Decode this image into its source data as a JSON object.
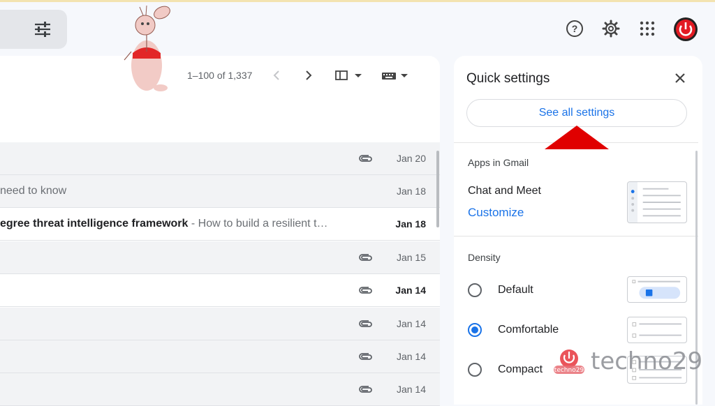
{
  "header": {
    "filter_icon": "tune-icon",
    "help_icon": "help-icon",
    "settings_icon": "gear-icon",
    "apps_icon": "apps-grid-icon",
    "avatar_icon": "power-avatar-icon"
  },
  "toolbar": {
    "pagination": "1–100 of 1,337",
    "prev_icon": "chevron-left-icon",
    "next_icon": "chevron-right-icon",
    "split_icon": "split-pane-icon",
    "input_tools_icon": "keyboard-icon"
  },
  "emails": [
    {
      "subject": "",
      "snippet": "",
      "date": "Jan 20",
      "attachment": true,
      "unread": false
    },
    {
      "subject": "",
      "snippet": "need to know",
      "date": "Jan 18",
      "attachment": false,
      "unread": false
    },
    {
      "subject": "egree threat intelligence framework",
      "snippet": " - How to build a resilient t…",
      "date": "Jan 18",
      "attachment": false,
      "unread": true
    },
    {
      "subject": "",
      "snippet": "",
      "date": "Jan 15",
      "attachment": true,
      "unread": false
    },
    {
      "subject": "",
      "snippet": "",
      "date": "Jan 14",
      "attachment": true,
      "unread": true
    },
    {
      "subject": "",
      "snippet": "",
      "date": "Jan 14",
      "attachment": true,
      "unread": false
    },
    {
      "subject": "",
      "snippet": "",
      "date": "Jan 14",
      "attachment": true,
      "unread": false
    },
    {
      "subject": "",
      "snippet": "",
      "date": "Jan 14",
      "attachment": true,
      "unread": false
    }
  ],
  "quick_settings": {
    "title": "Quick settings",
    "see_all": "See all settings",
    "apps_section": "Apps in Gmail",
    "chat_meet": "Chat and Meet",
    "customize": "Customize",
    "density_section": "Density",
    "density_options": [
      {
        "label": "Default",
        "selected": false
      },
      {
        "label": "Comfortable",
        "selected": true
      },
      {
        "label": "Compact",
        "selected": false
      }
    ]
  },
  "watermark": {
    "text": "techno29",
    "badge": "techno29"
  },
  "colors": {
    "accent": "#1a73e8",
    "arrow": "#e00000",
    "avatar": "#e31b23"
  }
}
